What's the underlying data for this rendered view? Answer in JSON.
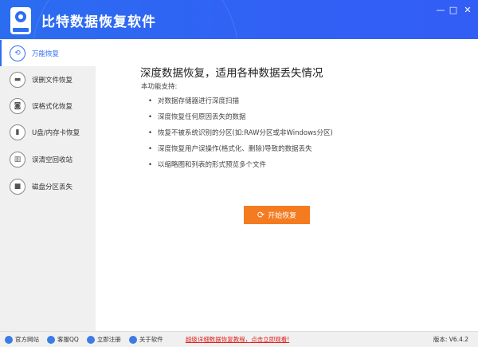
{
  "app": {
    "title": "比特数据恢复软件",
    "brand_color": "#3160f5",
    "accent": "#f47b20"
  },
  "window": {
    "minimize": "—",
    "maximize": "□",
    "close": "✕"
  },
  "sidebar": {
    "items": [
      {
        "label": "万能恢复",
        "icon": "refresh-icon",
        "glyph": "⟲",
        "active": true
      },
      {
        "label": "误删文件恢复",
        "icon": "folder-icon",
        "glyph": "▬"
      },
      {
        "label": "误格式化恢复",
        "icon": "disk-format-icon",
        "glyph": "◙"
      },
      {
        "label": "U盘/内存卡恢复",
        "icon": "usb-icon",
        "glyph": "▮"
      },
      {
        "label": "误清空回收站",
        "icon": "trash-icon",
        "glyph": "▥"
      },
      {
        "label": "磁盘分区丢失",
        "icon": "partition-icon",
        "glyph": "■"
      }
    ]
  },
  "main": {
    "heading": "深度数据恢复，适用各种数据丢失情况",
    "subheading": "本功能支持:",
    "features": [
      "对数据存储器进行深度扫描",
      "深度恢复任何原因丢失的数据",
      "恢复不被系统识别的分区(如:RAW分区或非Windows分区)",
      "深度恢复用户误操作(格式化、删除)导致的数据丢失",
      "以缩略图和列表的形式预览多个文件"
    ],
    "start_button": "开始恢复",
    "start_icon": "⟳"
  },
  "footer": {
    "links": [
      "官方网站",
      "客服QQ",
      "立即注册",
      "关于软件"
    ],
    "promo": "超级详细数据恢复教程，点击立即观看!",
    "version": "版本: V6.4.2"
  }
}
